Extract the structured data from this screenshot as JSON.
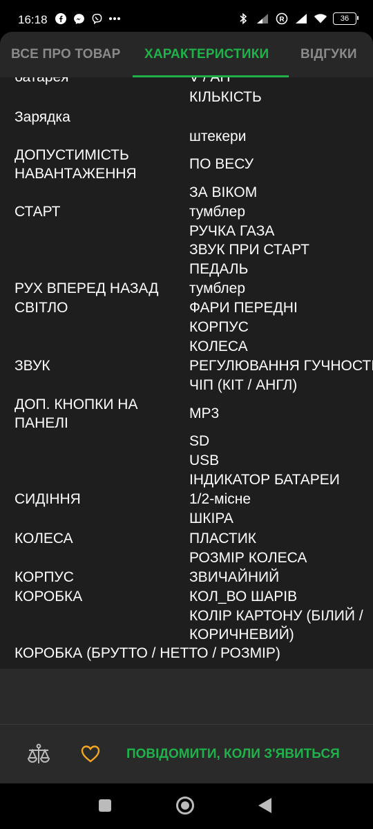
{
  "status_bar": {
    "time": "16:18",
    "battery": "36",
    "left_icons": [
      "facebook-icon",
      "messenger-icon",
      "viber-icon",
      "more-dots-icon"
    ],
    "right_icons": [
      "bluetooth-icon",
      "signal-icon",
      "registered-icon",
      "signal-icon",
      "wifi-icon",
      "battery-icon"
    ]
  },
  "tabs": [
    {
      "label": "ВСЕ ПРО ТОВАР",
      "active": false
    },
    {
      "label": "ХАРАКТЕРИСТИКИ",
      "active": true
    },
    {
      "label": "ВІДГУКИ",
      "active": false
    }
  ],
  "specs": {
    "left": [
      "батарея",
      "Зарядка",
      "ДОПУСТИМІСТЬ НАВАНТАЖЕННЯ",
      "СТАРТ",
      "РУХ ВПЕРЕД НАЗАД",
      "СВІТЛО",
      "ЗВУК",
      "ДОП. КНОПКИ НА ПАНЕЛІ",
      "СИДІННЯ",
      "КОЛЕСА",
      "КОРПУС",
      "КОРОБКА",
      "КОРОБКА (БРУТТО / НЕТТО / РОЗМІР)"
    ],
    "right": [
      "V / AH",
      "КІЛЬКІСТЬ",
      "штекери",
      "ПО ВЕСУ",
      "ЗА ВІКОМ",
      "тумблер",
      "РУЧКА ГАЗА",
      "ЗВУК ПРИ СТАРТ",
      "ПЕДАЛЬ",
      "тумблер",
      "ФАРИ ПЕРЕДНІ",
      "КОРПУС",
      "КОЛЕСА",
      "РЕГУЛЮВАННЯ ГУЧНОСТІ",
      "ЧІП (КІТ / АНГЛ)",
      "MP3",
      "SD",
      "USB",
      "ІНДИКАТОР БАТАРЕИ",
      "1/2-місне",
      "ШКІРА",
      "ПЛАСТИК",
      "РОЗМІР КОЛЕСА",
      "ЗВИЧАЙНИЙ",
      "КОЛ_ВО ШАРІВ",
      "КОЛІР КАРТОНУ (БІЛИЙ / КОРИЧНЕВИЙ)"
    ]
  },
  "actions": {
    "compare_icon": "scales-icon",
    "favorite_icon": "heart-icon",
    "notify_label": "ПОВІДОМИТИ, КОЛИ З'ЯВИТЬСЯ"
  },
  "colors": {
    "accent": "#20b24a",
    "heart": "#f5a623",
    "background": "#1e1e1e"
  }
}
